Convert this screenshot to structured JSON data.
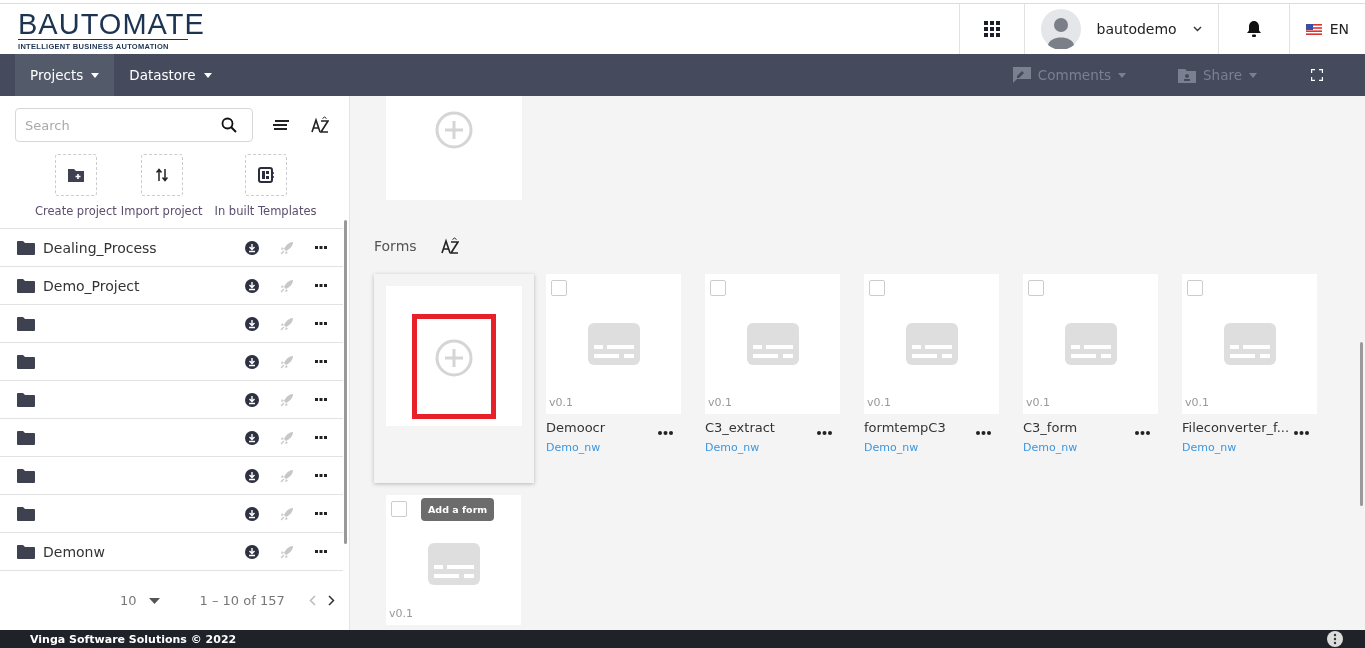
{
  "header": {
    "logo": {
      "title": "BAUTOMATE",
      "tagline": "INTELLIGENT BUSINESS AUTOMATION"
    },
    "user": {
      "name": "bautodemo"
    },
    "language": "EN"
  },
  "nav": {
    "menus": [
      {
        "label": "Projects",
        "selected": true
      },
      {
        "label": "Datastore",
        "selected": false
      }
    ],
    "actions": [
      {
        "kind": "comment",
        "label": "Comments",
        "disabled": true
      },
      {
        "kind": "share",
        "label": "Share",
        "disabled": true
      }
    ]
  },
  "sidebar": {
    "search": {
      "placeholder": "Search"
    },
    "actions": [
      {
        "kind": "create",
        "label": "Create project"
      },
      {
        "kind": "import",
        "label": "Import project"
      },
      {
        "kind": "templates",
        "label": "In built Templates"
      }
    ],
    "projects": [
      {
        "kind": "folder",
        "name": "Dealing_Process"
      },
      {
        "kind": "folder",
        "name": "Demo_Project"
      },
      {
        "kind": "folder"
      },
      {
        "kind": "folder"
      },
      {
        "kind": "folder"
      },
      {
        "kind": "folder"
      },
      {
        "kind": "folder"
      },
      {
        "kind": "folder"
      },
      {
        "kind": "folder",
        "name": "Demonw"
      }
    ],
    "pagination": {
      "page_size": "10",
      "range": "1 – 10 of 157"
    }
  },
  "forms": {
    "title": "Forms",
    "add_tooltip": "Add a form",
    "items": [
      {
        "name": "Demoocr",
        "version": "v0.1",
        "project": "Demo_nw",
        "checked": false
      },
      {
        "name": "C3_extract",
        "version": "v0.1",
        "project": "Demo_nw",
        "checked": false
      },
      {
        "name": "formtempC3",
        "version": "v0.1",
        "project": "Demo_nw",
        "checked": false
      },
      {
        "name": "C3_form",
        "version": "v0.1",
        "project": "Demo_nw",
        "checked": false
      },
      {
        "name": "Fileconverter_f...",
        "version": "v0.1",
        "project": "Demo_nw",
        "checked": false
      },
      {
        "version": "v0.1",
        "checked": false
      }
    ]
  },
  "footer": {
    "text": "Vinga Software Solutions © 2022"
  }
}
